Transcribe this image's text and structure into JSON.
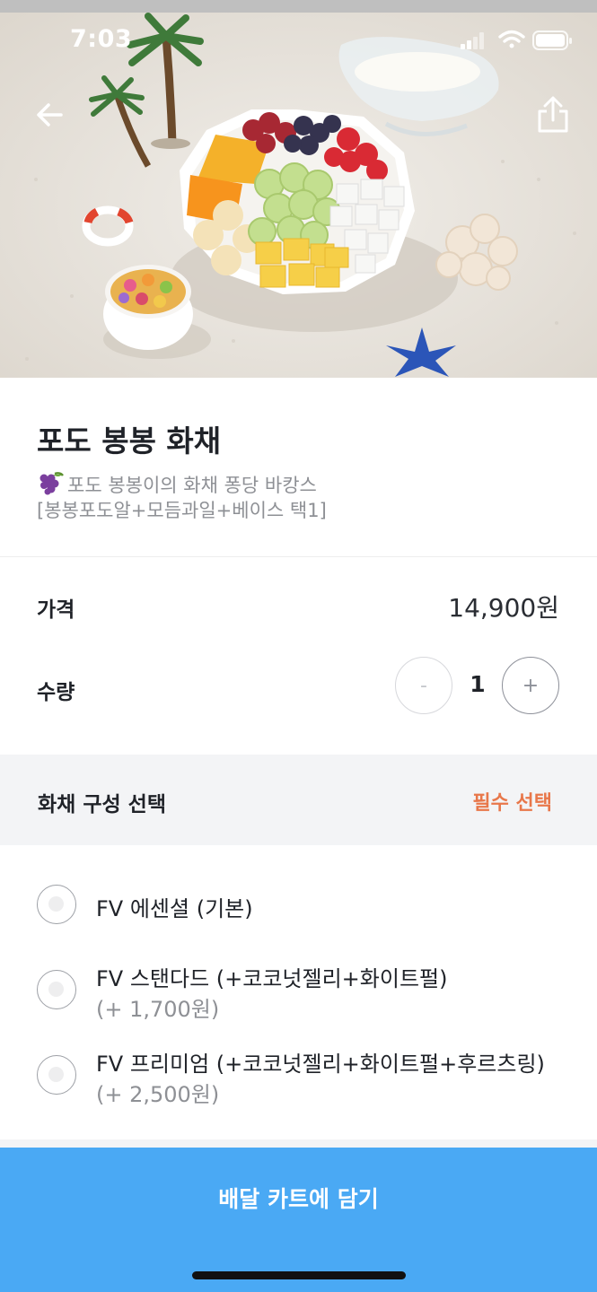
{
  "status_bar": {
    "time": "7:03",
    "icons": [
      "signal-icon",
      "wifi-icon",
      "battery-icon"
    ]
  },
  "nav": {
    "back_icon": "arrow-left-icon",
    "share_icon": "share-icon"
  },
  "product": {
    "title": "포도 봉봉 화채",
    "description_line1": "포도 봉봉이의 화채 퐁당 바캉스",
    "description_line2": "[봉봉포도알+모듬과일+베이스 택1]",
    "emoji": "grape-icon"
  },
  "price": {
    "label": "가격",
    "value": "14,900원"
  },
  "quantity": {
    "label": "수량",
    "value": "1",
    "minus": "-",
    "plus": "+"
  },
  "option_group": {
    "title": "화채 구성 선택",
    "badge": "필수 선택",
    "options": [
      {
        "name": "FV 에센셜 (기본)",
        "price": ""
      },
      {
        "name": "FV 스탠다드 (+코코넛젤리+화이트펄)",
        "price": "(+ 1,700원)"
      },
      {
        "name": "FV 프리미엄 (+코코넛젤리+화이트펄+후르츠링)",
        "price": "(+ 2,500원)"
      }
    ]
  },
  "cta": {
    "label": "배달 카트에 담기"
  },
  "colors": {
    "accent": "#4aa9f4",
    "required": "#e8774a",
    "muted": "#8e9095",
    "section_bg": "#f3f4f6"
  }
}
